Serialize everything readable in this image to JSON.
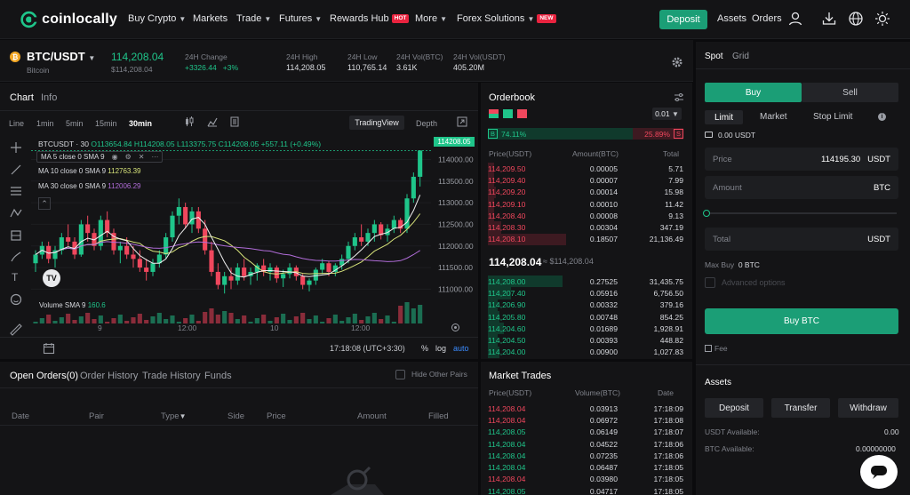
{
  "brand": {
    "name": "coinlocally",
    "accent": "#1b9e76"
  },
  "nav": {
    "buy_crypto": "Buy Crypto",
    "markets": "Markets",
    "trade": "Trade",
    "futures": "Futures",
    "rewards_hub": "Rewards Hub",
    "hot_badge": "HOT",
    "more": "More",
    "forex_solutions": "Forex Solutions",
    "new_badge": "NEW",
    "deposit": "Deposit",
    "assets": "Assets",
    "orders": "Orders",
    "icons": [
      "user-icon",
      "download-icon",
      "globe-icon",
      "theme-sun-icon"
    ]
  },
  "ticker": {
    "pair": "BTC/USDT",
    "coin": "Bitcoin",
    "coin_symbol": "₿",
    "price": "114,208.04",
    "price_usd": "$114,208.04",
    "change_label": "24H Change",
    "change": "+3326.44",
    "change_pct": "+3%",
    "high_label": "24H High",
    "high": "114,208.05",
    "low_label": "24H Low",
    "low": "110,765.14",
    "vol_btc_label": "24H Vol(BTC)",
    "vol_btc": "3.61K",
    "vol_usdt_label": "24H Vol(USDT)",
    "vol_usdt": "405.20M"
  },
  "chart": {
    "tab_chart": "Chart",
    "tab_info": "Info",
    "timeframes": [
      "Line",
      "1min",
      "5min",
      "15min",
      "30min"
    ],
    "active_timeframe": "30min",
    "tradingview": "TradingView",
    "depth": "Depth",
    "symbol_line": "BTCUSDT · 30",
    "ohlc": "O113654.84 H114208.05 L113375.75 C114208.05 +557.11 (+0.49%)",
    "ma5_label": "MA 5 close 0 SMA 9",
    "ma10_label": "MA 10 close 0 SMA 9",
    "ma10_value": "112763.39",
    "ma30_label": "MA 30 close 0 SMA 9",
    "ma30_value": "112006.29",
    "volume_label": "Volume SMA 9",
    "volume_value": "160.6",
    "last_price_tag": "114208.05",
    "time_labels": [
      "9",
      "12:00",
      "10",
      "12:00"
    ],
    "clock": "17:18:08 (UTC+3:30)",
    "pct_btn": "%",
    "log_btn": "log",
    "auto_btn": "auto"
  },
  "chart_data": {
    "type": "line",
    "y_ticks": [
      114000,
      113500,
      113000,
      112500,
      112000,
      111500,
      111000
    ],
    "y_tick_labels": [
      "114000.00",
      "113500.00",
      "113000.00",
      "112500.00",
      "112000.00",
      "111500.00",
      "111000.00"
    ],
    "ylim": [
      110700,
      114400
    ],
    "candles": [
      [
        111600,
        111900,
        111400,
        111800
      ],
      [
        111800,
        112100,
        111700,
        112000
      ],
      [
        112000,
        112100,
        111600,
        111700
      ],
      [
        111700,
        112000,
        111500,
        111900
      ],
      [
        111900,
        112300,
        111800,
        112200
      ],
      [
        112200,
        112500,
        112000,
        112100
      ],
      [
        112100,
        112200,
        111700,
        111800
      ],
      [
        111800,
        112600,
        111750,
        112500
      ],
      [
        112500,
        112700,
        112100,
        112300
      ],
      [
        112300,
        112400,
        111900,
        112000
      ],
      [
        112000,
        112700,
        111900,
        112600
      ],
      [
        112600,
        112800,
        112200,
        112300
      ],
      [
        112300,
        112400,
        111800,
        111900
      ],
      [
        111900,
        112100,
        111600,
        112000
      ],
      [
        112000,
        112200,
        111700,
        111800
      ],
      [
        111800,
        112000,
        111500,
        111700
      ],
      [
        111700,
        111900,
        111400,
        111500
      ],
      [
        111500,
        111700,
        111200,
        111400
      ],
      [
        111400,
        111700,
        111300,
        111600
      ],
      [
        111600,
        111900,
        111500,
        111800
      ],
      [
        111800,
        112300,
        111700,
        112200
      ],
      [
        112200,
        112800,
        112100,
        112700
      ],
      [
        112700,
        113100,
        112500,
        112900
      ],
      [
        112900,
        113000,
        112400,
        112500
      ],
      [
        112500,
        112900,
        112300,
        112800
      ],
      [
        112800,
        112900,
        112300,
        112400
      ],
      [
        112400,
        112600,
        111800,
        111900
      ],
      [
        111900,
        112100,
        111300,
        111400
      ],
      [
        111400,
        111600,
        111000,
        111100
      ],
      [
        111100,
        111400,
        110900,
        111300
      ],
      [
        111300,
        111500,
        111000,
        111200
      ],
      [
        111200,
        111600,
        111100,
        111500
      ],
      [
        111500,
        111700,
        111200,
        111300
      ],
      [
        111300,
        111500,
        111100,
        111400
      ],
      [
        111400,
        111600,
        111200,
        111550
      ],
      [
        111550,
        111700,
        111300,
        111400
      ],
      [
        111400,
        111600,
        111200,
        111500
      ],
      [
        111500,
        111550,
        111150,
        111250
      ],
      [
        111250,
        111450,
        111050,
        111350
      ],
      [
        111350,
        111600,
        111250,
        111500
      ],
      [
        111500,
        111550,
        111200,
        111300
      ],
      [
        111300,
        111350,
        111000,
        111100
      ],
      [
        111100,
        111250,
        110950,
        111200
      ],
      [
        111200,
        111500,
        111100,
        111450
      ],
      [
        111450,
        111700,
        111350,
        111600
      ],
      [
        111600,
        111650,
        111300,
        111400
      ],
      [
        111400,
        111600,
        111300,
        111550
      ],
      [
        111550,
        111800,
        111450,
        111700
      ],
      [
        111700,
        112100,
        111600,
        112000
      ],
      [
        112000,
        112300,
        111900,
        112200
      ],
      [
        112200,
        112500,
        112000,
        112100
      ],
      [
        112100,
        112400,
        112000,
        112300
      ],
      [
        112300,
        112600,
        112100,
        112500
      ],
      [
        112500,
        112550,
        112150,
        112250
      ],
      [
        112250,
        112500,
        112100,
        112400
      ],
      [
        112400,
        112700,
        112300,
        112600
      ],
      [
        112600,
        112650,
        112300,
        112400
      ],
      [
        112400,
        113200,
        112300,
        113100
      ],
      [
        113100,
        113700,
        113000,
        113600
      ],
      [
        113600,
        114208,
        113375,
        114208
      ]
    ],
    "ma_series": [
      {
        "name": "MA 10 close 0 SMA 9",
        "color": "#d6e27a"
      },
      {
        "name": "MA 30 close 0 SMA 9",
        "color": "#b06cd8"
      },
      {
        "name": "MA 5 close 0 SMA 9",
        "color": "#f0f0f0"
      }
    ]
  },
  "orderbook": {
    "title": "Orderbook",
    "precision": "0.01",
    "buy_letter": "B",
    "buy_pct": "74.11%",
    "sell_pct": "25.89%",
    "sell_letter": "S",
    "col_price": "Price(USDT)",
    "col_amount": "Amount(BTC)",
    "col_total": "Total",
    "asks": [
      {
        "price": "114,209.50",
        "amount": "0.00005",
        "total": "5.71",
        "depth": 0.03
      },
      {
        "price": "114,209.40",
        "amount": "0.00007",
        "total": "7.99",
        "depth": 0.03
      },
      {
        "price": "114,209.20",
        "amount": "0.00014",
        "total": "15.98",
        "depth": 0.04
      },
      {
        "price": "114,209.10",
        "amount": "0.00010",
        "total": "11.42",
        "depth": 0.03
      },
      {
        "price": "114,208.40",
        "amount": "0.00008",
        "total": "9.13",
        "depth": 0.03
      },
      {
        "price": "114,208.30",
        "amount": "0.00304",
        "total": "347.19",
        "depth": 0.07
      },
      {
        "price": "114,208.10",
        "amount": "0.18507",
        "total": "21,136.49",
        "depth": 0.4
      }
    ],
    "mid_price": "114,208.04",
    "mid_usd": "≈ $114,208.04",
    "bids": [
      {
        "price": "114,208.00",
        "amount": "0.27525",
        "total": "31,435.75",
        "depth": 0.38
      },
      {
        "price": "114,207.40",
        "amount": "0.05916",
        "total": "6,756.50",
        "depth": 0.12
      },
      {
        "price": "114,206.90",
        "amount": "0.00332",
        "total": "379.16",
        "depth": 0.05
      },
      {
        "price": "114,205.80",
        "amount": "0.00748",
        "total": "854.25",
        "depth": 0.06
      },
      {
        "price": "114,204.60",
        "amount": "0.01689",
        "total": "1,928.91",
        "depth": 0.08
      },
      {
        "price": "114,204.50",
        "amount": "0.00393",
        "total": "448.82",
        "depth": 0.05
      },
      {
        "price": "114,204.00",
        "amount": "0.00900",
        "total": "1,027.83",
        "depth": 0.06
      }
    ]
  },
  "orders": {
    "tabs": [
      "Open Orders(0)",
      "Order History",
      "Trade History",
      "Funds"
    ],
    "hide_other_pairs": "Hide Other Pairs",
    "columns": [
      "Date",
      "Pair",
      "Type",
      "Side",
      "Price",
      "Amount",
      "Filled"
    ]
  },
  "trades": {
    "title": "Market Trades",
    "col_price": "Price(USDT)",
    "col_volume": "Volume(BTC)",
    "col_date": "Date",
    "rows": [
      {
        "price": "114,208.04",
        "volume": "0.03913",
        "time": "17:18:09",
        "side": "sell"
      },
      {
        "price": "114,208.04",
        "volume": "0.06972",
        "time": "17:18:08",
        "side": "sell"
      },
      {
        "price": "114,208.05",
        "volume": "0.06149",
        "time": "17:18:07",
        "side": "buy"
      },
      {
        "price": "114,208.04",
        "volume": "0.04522",
        "time": "17:18:06",
        "side": "buy"
      },
      {
        "price": "114,208.04",
        "volume": "0.07235",
        "time": "17:18:06",
        "side": "buy"
      },
      {
        "price": "114,208.04",
        "volume": "0.06487",
        "time": "17:18:05",
        "side": "buy"
      },
      {
        "price": "114,208.04",
        "volume": "0.03980",
        "time": "17:18:05",
        "side": "sell"
      },
      {
        "price": "114,208.05",
        "volume": "0.04717",
        "time": "17:18:05",
        "side": "buy"
      }
    ]
  },
  "form": {
    "tab_spot": "Spot",
    "tab_grid": "Grid",
    "buy": "Buy",
    "sell": "Sell",
    "limit": "Limit",
    "market": "Market",
    "stop_limit": "Stop Limit",
    "balance": "0.00 USDT",
    "price_label": "Price",
    "price_value": "114195.30",
    "price_unit": "USDT",
    "amount_label": "Amount",
    "amount_unit": "BTC",
    "total_label": "Total",
    "total_unit": "USDT",
    "max_buy_label": "Max Buy",
    "max_buy_value": "0 BTC",
    "advanced": "Advanced options",
    "buy_btc": "Buy BTC",
    "fee": "Fee",
    "assets_title": "Assets",
    "deposit": "Deposit",
    "transfer": "Transfer",
    "withdraw": "Withdraw",
    "usdt_available_label": "USDT Available:",
    "usdt_available": "0.00",
    "btc_available_label": "BTC Available:",
    "btc_available": "0.00000000"
  }
}
